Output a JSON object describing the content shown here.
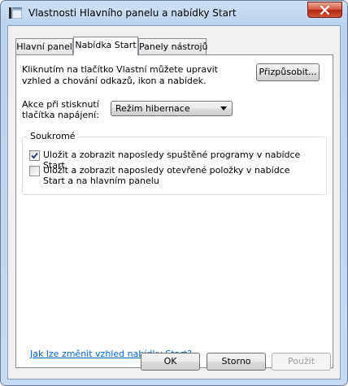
{
  "window": {
    "title": "Vlastnosti Hlavního panelu a nabídky Start",
    "app_icon": "taskbar-properties-icon",
    "close_icon": "close-icon"
  },
  "tabs": [
    {
      "label": "Hlavní panel",
      "active": false
    },
    {
      "label": "Nabídka Start",
      "active": true
    },
    {
      "label": "Panely nástrojů",
      "active": false
    }
  ],
  "start_menu": {
    "description": "Kliknutím na tlačítko Vlastní můžete upravit vzhled a chování odkazů, ikon a nabídek.",
    "customize_button": "Přizpůsobit...",
    "power_button_label": "Akce při stisknutí tlačítka napájení:",
    "power_button_value": "Režim hibernace"
  },
  "privacy": {
    "title": "Soukromé",
    "options": [
      {
        "label": "Uložit a zobrazit naposledy spuštěné programy v nabídce Start",
        "checked": true
      },
      {
        "label": "Uložit a zobrazit naposledy otevřené položky v nabídce Start a na hlavním panelu",
        "checked": false
      }
    ]
  },
  "help_link": "Jak lze změnit vzhled nabídky Start?",
  "buttons": {
    "ok": "OK",
    "cancel": "Storno",
    "apply": "Použít"
  },
  "colors": {
    "frame": "#bcd3ec",
    "link": "#0066cc",
    "close": "#c9533b"
  }
}
